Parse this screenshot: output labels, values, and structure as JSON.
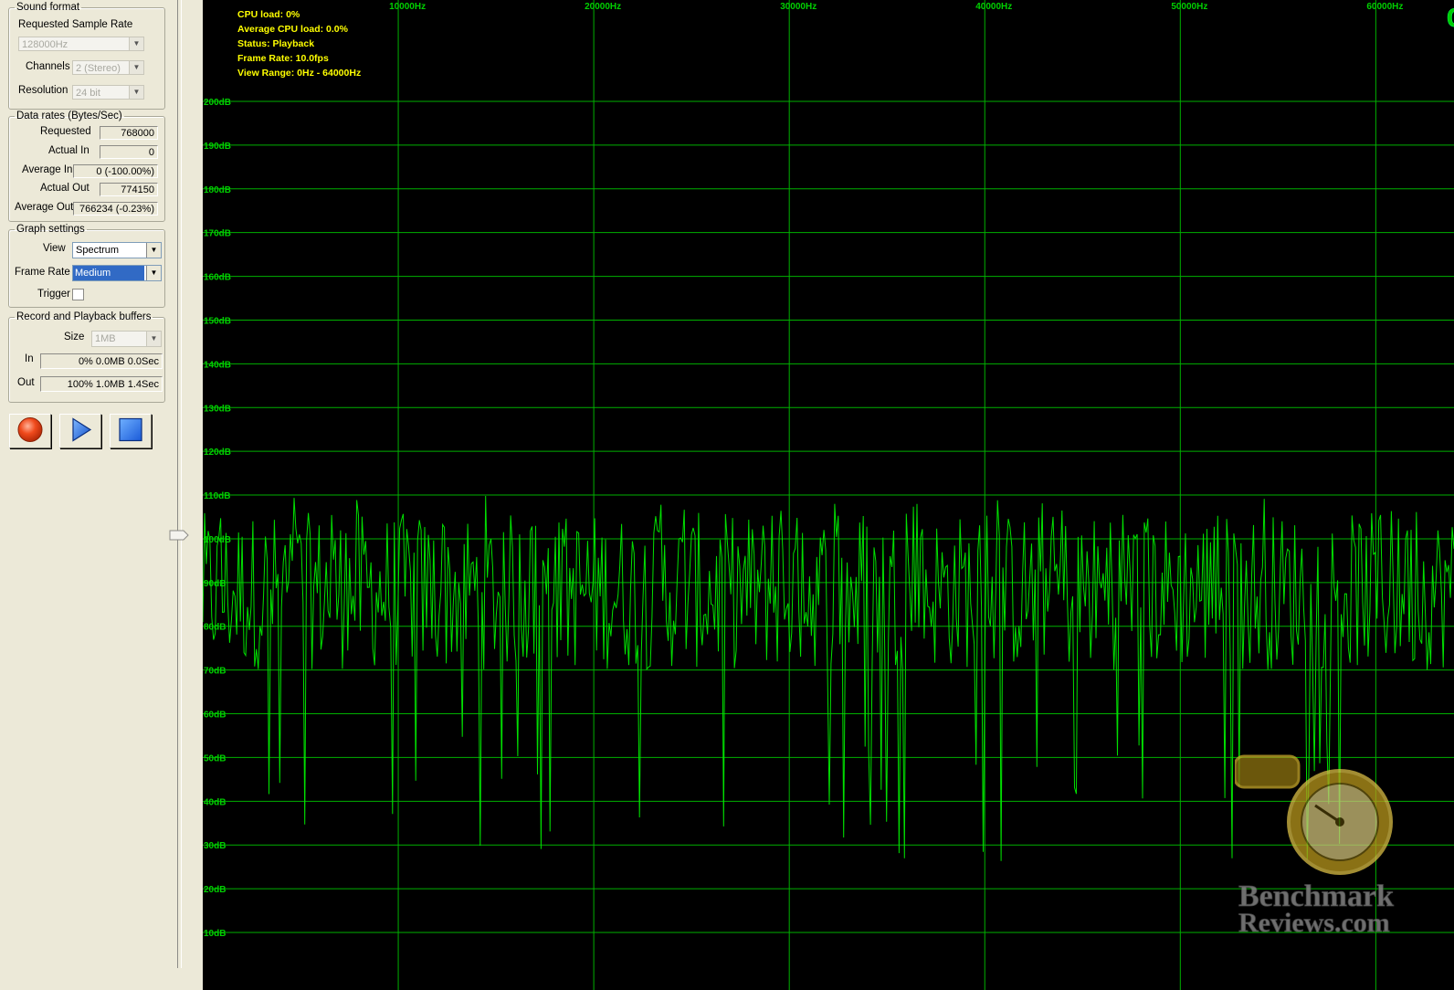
{
  "sound_format": {
    "legend": "Sound format",
    "sample_rate_label": "Requested Sample Rate",
    "sample_rate_value": "128000Hz",
    "channels_label": "Channels",
    "channels_value": "2 (Stereo)",
    "resolution_label": "Resolution",
    "resolution_value": "24 bit"
  },
  "data_rates": {
    "legend": "Data rates (Bytes/Sec)",
    "rows": [
      {
        "label": "Requested",
        "value": "768000"
      },
      {
        "label": "Actual In",
        "value": "0"
      },
      {
        "label": "Average In",
        "value": "0 (-100.00%)"
      },
      {
        "label": "Actual Out",
        "value": "774150"
      },
      {
        "label": "Average Out",
        "value": "766234 (-0.23%)"
      }
    ]
  },
  "graph_settings": {
    "legend": "Graph settings",
    "view_label": "View",
    "view_value": "Spectrum",
    "frame_rate_label": "Frame Rate",
    "frame_rate_value": "Medium",
    "trigger_label": "Trigger"
  },
  "buffers": {
    "legend": "Record and Playback buffers",
    "size_label": "Size",
    "size_value": "1MB",
    "in_label": "In",
    "in_value": "0% 0.0MB 0.0Sec",
    "out_label": "Out",
    "out_value": "100% 1.0MB 1.4Sec"
  },
  "transport": {
    "record_icon": "record-icon",
    "play_icon": "play-icon",
    "stop_icon": "stop-icon"
  },
  "status": {
    "cpu_load": "CPU load: 0%",
    "avg_cpu_load": "Average CPU load: 0.0%",
    "status": "Status: Playback",
    "frame_rate": "Frame Rate: 10.0fps",
    "view_range": "View Range: 0Hz - 64000Hz"
  },
  "out_logo": "OUT",
  "watermark": {
    "line1": "Benchmark",
    "line2": "Reviews.com"
  },
  "colors": {
    "grid": "#00b000",
    "trace": "#00e000",
    "status_text": "#ffff00",
    "background": "#000000",
    "out_logo": "#00cc00"
  },
  "chart_data": {
    "type": "line",
    "title": "",
    "x_tick_labels": [
      "10000Hz",
      "20000Hz",
      "30000Hz",
      "40000Hz",
      "50000Hz",
      "60000Hz"
    ],
    "y_tick_labels": [
      "200dB",
      "190dB",
      "180dB",
      "170dB",
      "160dB",
      "150dB",
      "140dB",
      "130dB",
      "120dB",
      "110dB",
      "100dB",
      "90dB",
      "80dB",
      "70dB",
      "60dB",
      "50dB",
      "40dB",
      "30dB",
      "20dB",
      "10dB"
    ],
    "xlim": [
      0,
      64000
    ],
    "ylim": [
      0,
      210
    ],
    "grid": true,
    "series": [
      {
        "description": "noise floor spectrum",
        "mean_db": 88,
        "range_db": [
          25,
          110
        ],
        "points": 700
      }
    ]
  }
}
